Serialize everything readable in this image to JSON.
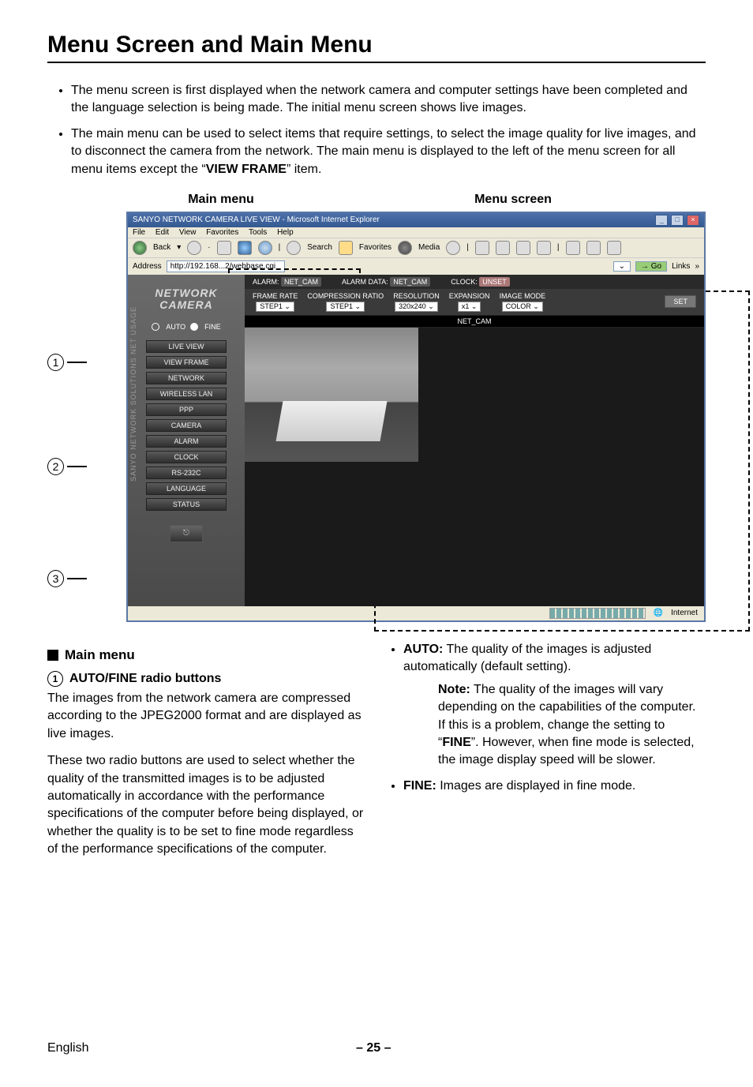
{
  "title": "Menu Screen and Main Menu",
  "bullets": {
    "b1": "The menu screen is first displayed when the network camera and computer settings have been completed and the language selection is being made. The initial menu screen shows live images.",
    "b2_pre": "The main menu can be used to select items that require settings, to select the image quality for live images, and to disconnect the camera from the network. The main menu is displayed to the left of the menu screen for all menu items except the “",
    "b2_bold": "VIEW FRAME",
    "b2_post": "” item."
  },
  "figureLabels": {
    "main": "Main menu",
    "screen": "Menu screen"
  },
  "callouts": {
    "c1": "1",
    "c2": "2",
    "c3": "3"
  },
  "browser": {
    "title": "SANYO NETWORK CAMERA LIVE VIEW - Microsoft Internet Explorer",
    "menus": {
      "file": "File",
      "edit": "Edit",
      "view": "View",
      "favorites": "Favorites",
      "tools": "Tools",
      "help": "Help"
    },
    "toolbar": {
      "back": "Back",
      "search": "Search",
      "favorites": "Favorites",
      "media": "Media"
    },
    "address_label": "Address",
    "address_value": "http://192.168...2/webbase.cgi",
    "go": "Go",
    "links": "Links",
    "status_zone": "Internet"
  },
  "sidebar": {
    "logo1": "NETWORK",
    "logo2": "CAMERA",
    "vtext": "SANYO NETWORK SOLUTIONS NET USAGE",
    "radio": {
      "auto": "AUTO",
      "fine": "FINE"
    },
    "items": [
      "LIVE VIEW",
      "VIEW FRAME",
      "NETWORK",
      "WIRELESS LAN",
      "PPP",
      "CAMERA",
      "ALARM",
      "CLOCK",
      "RS-232C",
      "LANGUAGE",
      "STATUS"
    ]
  },
  "infoBar": {
    "alarm_lbl": "ALARM:",
    "alarm_val": "NET_CAM",
    "alarmdata_lbl": "ALARM DATA:",
    "alarmdata_val": "NET_CAM",
    "clock_lbl": "CLOCK:",
    "clock_val": "UNSET"
  },
  "settingsBar": {
    "frame_rate": {
      "lbl": "FRAME RATE",
      "val": "STEP1"
    },
    "compression": {
      "lbl": "COMPRESSION RATIO",
      "val": "STEP1"
    },
    "resolution": {
      "lbl": "RESOLUTION",
      "val": "320x240"
    },
    "expansion": {
      "lbl": "EXPANSION",
      "val": "x1"
    },
    "image_mode": {
      "lbl": "IMAGE MODE",
      "val": "COLOR"
    },
    "set": "SET"
  },
  "videoLabel": "NET_CAM",
  "leftColumn": {
    "mainMenuHead": "Main menu",
    "sub1_num": "1",
    "sub1_text": "AUTO/FINE radio buttons",
    "p1": "The images from the network camera are compressed according to the JPEG2000 format and are displayed as live images.",
    "p2": "These two radio buttons are used to select whether the quality of the transmitted images is to be adjusted automatically in accordance with the performance specifications of the computer before being displayed, or whether the quality is to be set to fine mode regardless of the performance specifications of the computer."
  },
  "rightColumn": {
    "auto_lbl": "AUTO:",
    "auto_text": " The quality of the images is adjusted automatically (default setting).",
    "note_lbl": "Note:",
    "note_text_pre": " The quality of the images will vary depending on the capabilities of the computer. If this is a problem, change the setting to “",
    "note_bold": "FINE",
    "note_text_post": "”. However, when fine mode is selected, the image display speed will be slower.",
    "fine_lbl": "FINE:",
    "fine_text": " Images are displayed in fine mode."
  },
  "footer": {
    "lang": "English",
    "page": "– 25 –"
  }
}
